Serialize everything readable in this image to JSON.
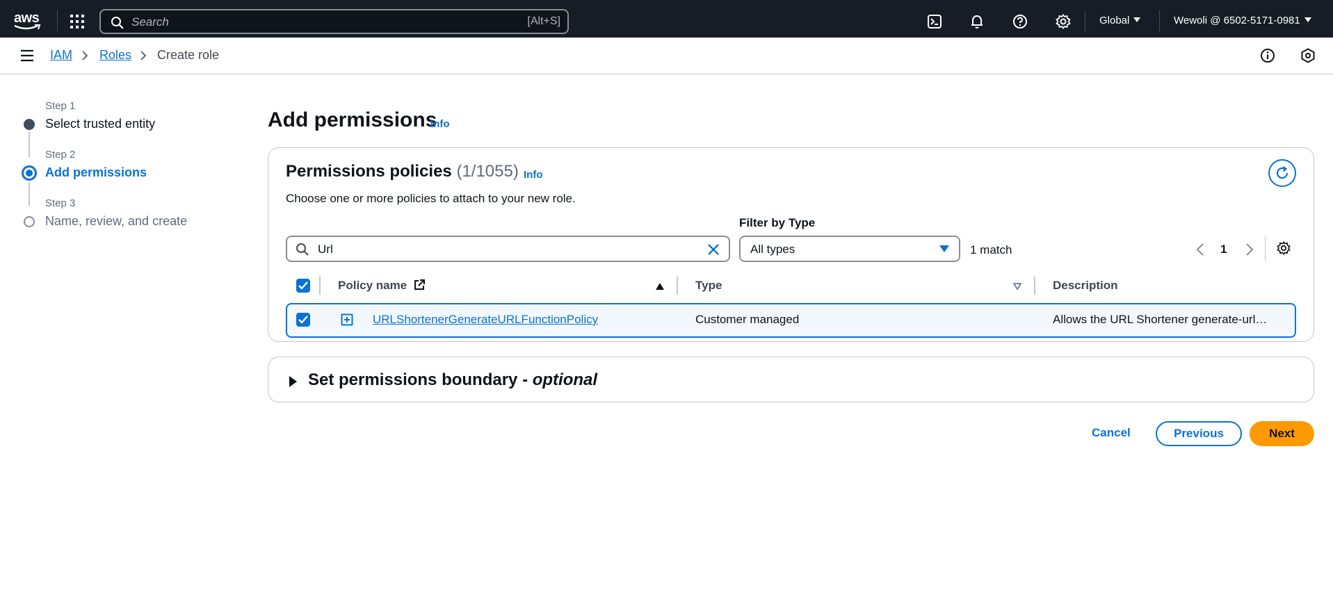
{
  "topnav": {
    "logo_text": "aws",
    "search_placeholder": "Search",
    "search_shortcut": "[Alt+S]",
    "region": "Global",
    "account": "Wewoli @ 6502-5171-0981"
  },
  "breadcrumb": {
    "items": [
      "IAM",
      "Roles",
      "Create role"
    ]
  },
  "wizard": {
    "steps": [
      {
        "label": "Step 1",
        "title": "Select trusted entity",
        "state": "completed"
      },
      {
        "label": "Step 2",
        "title": "Add permissions",
        "state": "active"
      },
      {
        "label": "Step 3",
        "title": "Name, review, and create",
        "state": "pending"
      }
    ]
  },
  "main": {
    "title": "Add permissions",
    "info_label": "Info"
  },
  "policies": {
    "title": "Permissions policies",
    "count": "(1/1055)",
    "info_label": "Info",
    "description": "Choose one or more policies to attach to your new role.",
    "search_value": "Url",
    "filter_label": "Filter by Type",
    "filter_value": "All types",
    "match_text": "1 match",
    "page_number": "1",
    "columns": [
      "Policy name",
      "Type",
      "Description"
    ],
    "rows": [
      {
        "name": "URLShortenerGenerateURLFunctionPolicy",
        "type": "Customer managed",
        "description": "Allows the URL Shortener generate-url…",
        "selected": true
      }
    ]
  },
  "boundary": {
    "title": "Set permissions boundary - ",
    "optional": "optional"
  },
  "actions": {
    "cancel": "Cancel",
    "previous": "Previous",
    "next": "Next"
  },
  "colors": {
    "nav_bg": "#161d26",
    "link": "#0972d3",
    "primary_button": "#ff9900",
    "selected_row_bg": "#f2f8fd"
  }
}
